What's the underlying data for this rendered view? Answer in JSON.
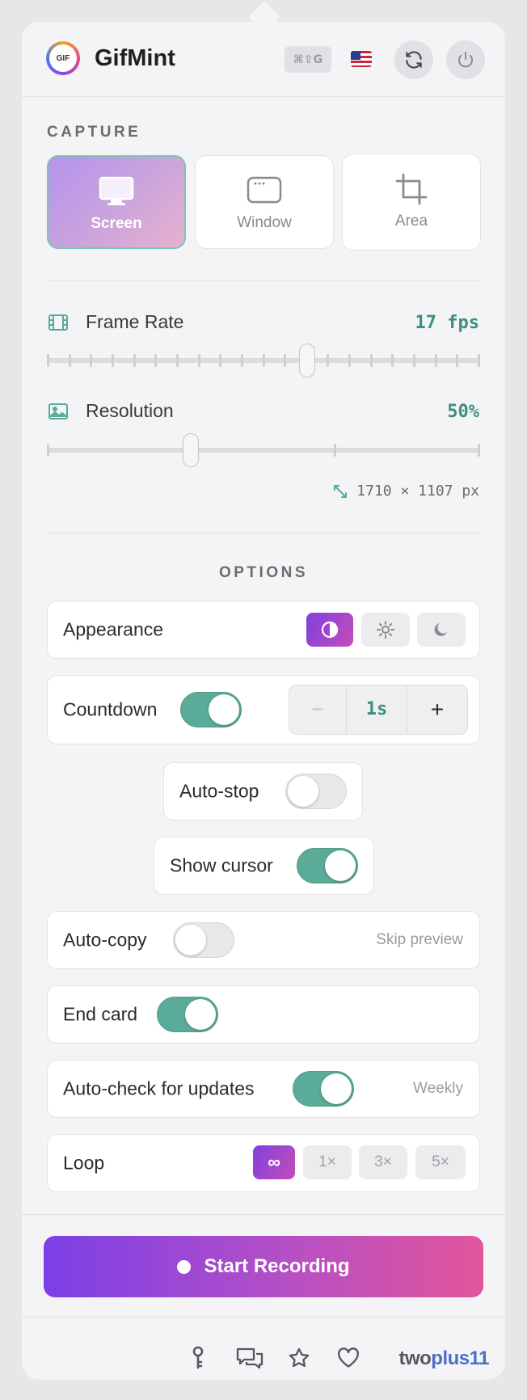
{
  "header": {
    "logo_text": "GIF",
    "app_name": "GifMint",
    "shortcut": "⌘⇧G",
    "language_icon": "us-flag-icon"
  },
  "capture": {
    "section_label": "CAPTURE",
    "modes": [
      {
        "label": "Screen",
        "icon": "monitor-icon",
        "selected": true
      },
      {
        "label": "Window",
        "icon": "window-icon",
        "selected": false
      },
      {
        "label": "Area",
        "icon": "crop-icon",
        "selected": false
      }
    ]
  },
  "frame_rate": {
    "label": "Frame Rate",
    "value": "17 fps",
    "level": 0.6
  },
  "resolution": {
    "label": "Resolution",
    "value": "50%",
    "level": 0.333,
    "dimensions": "1710 × 1107 px"
  },
  "options": {
    "section_label": "OPTIONS",
    "appearance": {
      "label": "Appearance",
      "modes": [
        "auto",
        "light",
        "dark"
      ],
      "selected": "auto"
    },
    "countdown": {
      "label": "Countdown",
      "enabled": true,
      "minus": "−",
      "value": "1s",
      "plus": "+"
    },
    "auto_stop": {
      "label": "Auto-stop",
      "enabled": false
    },
    "show_cursor": {
      "label": "Show cursor",
      "enabled": true
    },
    "auto_copy": {
      "label": "Auto-copy",
      "enabled": false,
      "hint": "Skip preview"
    },
    "end_card": {
      "label": "End card",
      "enabled": true
    },
    "auto_update": {
      "label": "Auto-check for updates",
      "enabled": true,
      "hint": "Weekly"
    },
    "loop": {
      "label": "Loop",
      "choices": [
        "∞",
        "1×",
        "3×",
        "5×"
      ],
      "selected": "∞"
    }
  },
  "start_button": {
    "label": "Start Recording"
  },
  "footer": {
    "icons": [
      "key-icon",
      "chat-icon",
      "star-icon",
      "heart-icon"
    ],
    "brand_prefix": "two",
    "brand_highlight": "plus11"
  },
  "colors": {
    "accent_purple": "#7b3fe6",
    "accent_pink": "#e2559b",
    "accent_green": "#5aab98"
  }
}
